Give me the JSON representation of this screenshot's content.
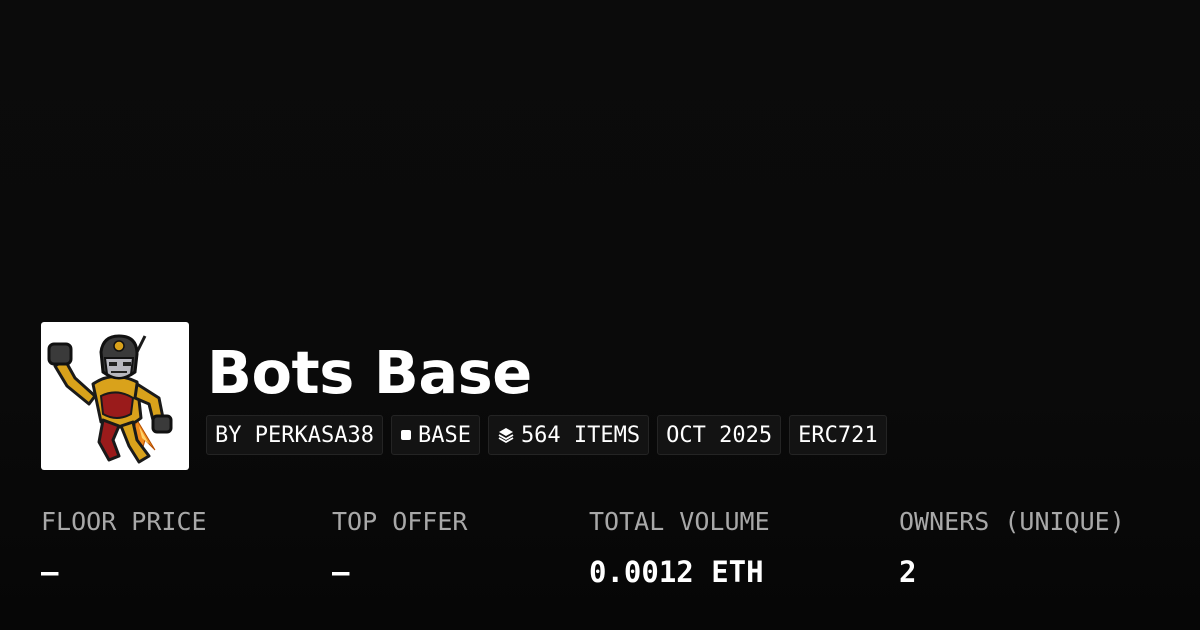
{
  "collection": {
    "name": "Bots Base",
    "avatar_icon": "robot-superhero-icon"
  },
  "tags": {
    "creator": "BY PERKASA38",
    "chain": "BASE",
    "chain_icon": "square-icon",
    "items": "564 ITEMS",
    "items_icon": "layers-icon",
    "date": "OCT 2025",
    "standard": "ERC721"
  },
  "stats": {
    "floor_price": {
      "label": "FLOOR PRICE",
      "value": "–"
    },
    "top_offer": {
      "label": "TOP OFFER",
      "value": "–"
    },
    "total_volume": {
      "label": "TOTAL VOLUME",
      "value": "0.0012 ETH"
    },
    "owners": {
      "label": "OWNERS (UNIQUE)",
      "value": "2"
    }
  },
  "colors": {
    "background": "#0a0a0a",
    "tag_background": "#131313",
    "label_gray": "#a8a8a8",
    "robot_gold": "#d9a21b",
    "robot_red": "#9a1b1b"
  }
}
